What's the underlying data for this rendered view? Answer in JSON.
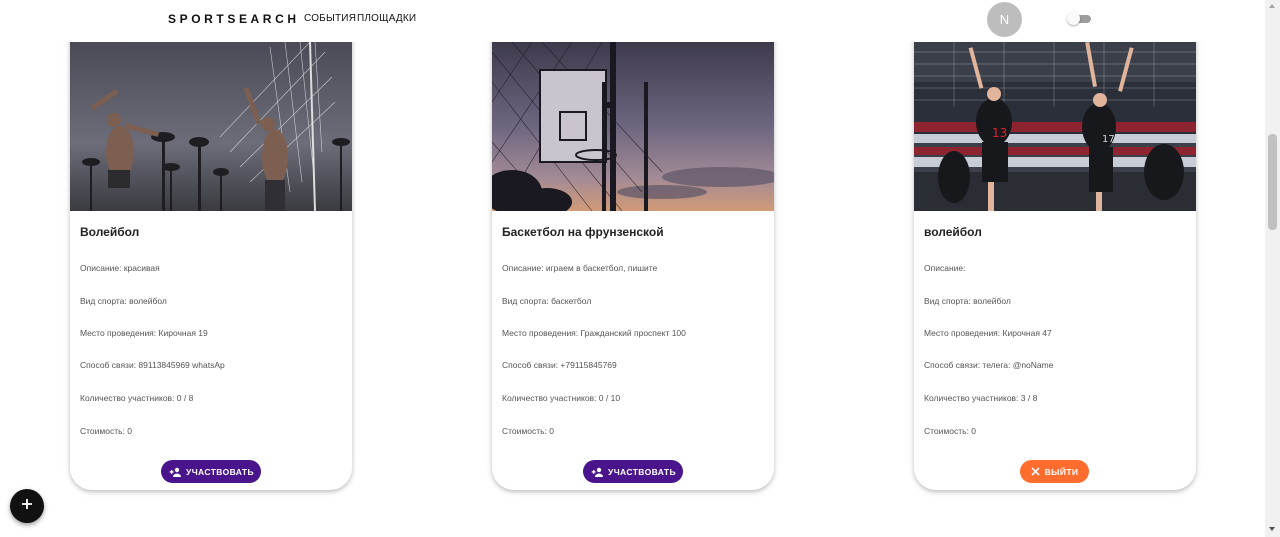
{
  "header": {
    "brand": "SPORTSEARCH",
    "nav": [
      "СОБЫТИЯ",
      "ПЛОЩАДКИ"
    ],
    "avatar_letter": "N",
    "theme_toggle_on": false
  },
  "colors": {
    "join_button": "#4a148c",
    "leave_button": "#ff6d2e",
    "fab": "#111111"
  },
  "events": [
    {
      "title": "Волейбол",
      "description": "Описание: красивая",
      "sport": "Вид спорта: волейбол",
      "place": "Место проведения: Кирочная 19",
      "contact": "Способ связи: 89113845969 whatsAp",
      "participants": "Количество участников: 0 / 8",
      "cost": "Стоимость: 0",
      "action": "УЧАСТВОВАТЬ",
      "action_icon": "person-add-icon"
    },
    {
      "title": "Баскетбол на фрунзенской",
      "description": "Описание: играем в баскетбол, пишите",
      "sport": "Вид спорта: баскетбол",
      "place": "Место проведения: Гражданский проспект 100",
      "contact": "Способ связи: +79115845769",
      "participants": "Количество участников: 0 / 10",
      "cost": "Стоимость: 0",
      "action": "УЧАСТВОВАТЬ",
      "action_icon": "person-add-icon"
    },
    {
      "title": "волейбол",
      "description": "Описание:",
      "sport": "Вид спорта: волейбол",
      "place": "Место проведения: Кирочная 47",
      "contact": "Способ связи: телега: @noName",
      "participants": "Количество участников: 3 / 8",
      "cost": "Стоимость: 0",
      "action": "ВЫЙТИ",
      "action_icon": "close-icon"
    }
  ],
  "fab": {
    "icon": "plus-icon"
  }
}
